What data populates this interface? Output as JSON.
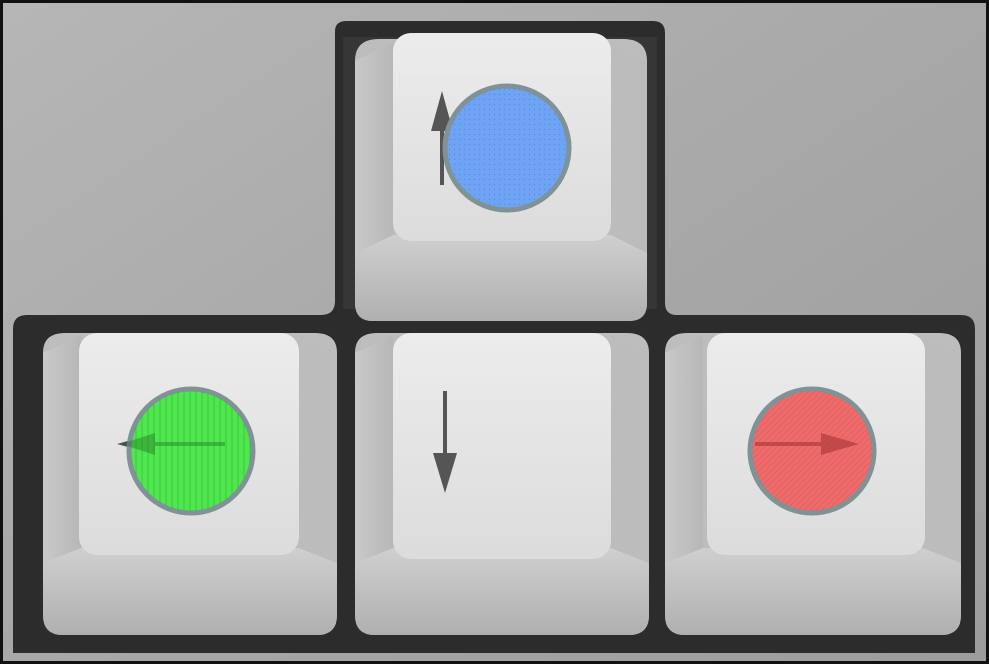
{
  "scene": {
    "subject": "keyboard-arrow-keys",
    "keys": [
      {
        "id": "up",
        "arrow": "up-arrow-icon",
        "marker_color": "#6fa3f4"
      },
      {
        "id": "left",
        "arrow": "left-arrow-icon",
        "marker_color": "#4fe64f"
      },
      {
        "id": "down",
        "arrow": "down-arrow-icon",
        "marker_color": ""
      },
      {
        "id": "right",
        "arrow": "right-arrow-icon",
        "marker_color": "#ee6b6b"
      }
    ],
    "colors": {
      "panel": "#a9a9a9",
      "key_top": "#e4e4e4",
      "key_side": "#c4c4c4",
      "well": "#2a2a2a",
      "marker_ring": "#7f9295"
    }
  }
}
